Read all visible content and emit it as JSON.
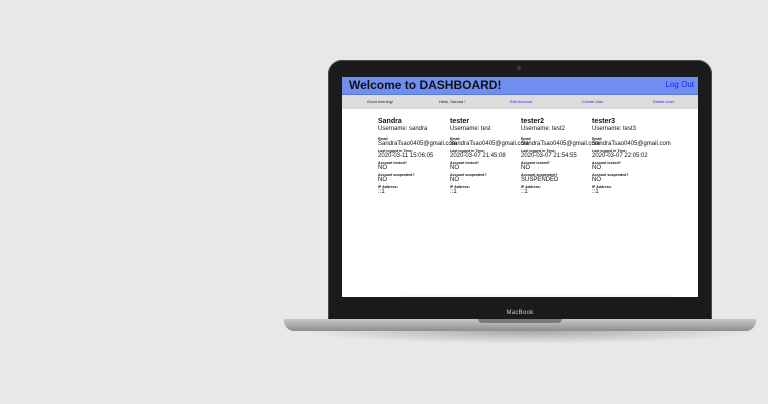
{
  "device": {
    "brand": "MacBook"
  },
  "app": {
    "title": "Welcome to DASHBOARD!",
    "logout": "Log Out",
    "accent_color": "#6f8ef0"
  },
  "nav": {
    "greeting": "Good evening!",
    "hello": "Hello, Sandra !",
    "edit_account": "Edit Account",
    "create_user": "Create User",
    "delete_user": "Delete User"
  },
  "labels": {
    "email": "Email",
    "last_logged": "Last logged in Time:",
    "locked": "Account locked?",
    "suspended": "Account suspended?",
    "ip": "IP Address:"
  },
  "users": [
    {
      "name": "Sandra",
      "username": "Username: sandra",
      "email": "SandraTsao0405@gmail.com",
      "last_logged": "2020-03-11 15:06:05",
      "locked": "NO",
      "suspended": "NO",
      "ip": "::1"
    },
    {
      "name": "tester",
      "username": "Username: test",
      "email": "SandraTsao0405@gmail.com",
      "last_logged": "2020-03-07 21:45:08",
      "locked": "NO",
      "suspended": "NO",
      "ip": "::1"
    },
    {
      "name": "tester2",
      "username": "Username: test2",
      "email": "SandraTsao0405@gmail.com",
      "last_logged": "2020-03-07 21:54:55",
      "locked": "NO",
      "suspended": "SUSPENDED",
      "ip": "::1"
    },
    {
      "name": "tester3",
      "username": "Username: test3",
      "email": "SandraTsao0405@gmail.com",
      "last_logged": "2020-03-07 22:05:02",
      "locked": "NO",
      "suspended": "NO",
      "ip": "::1"
    }
  ]
}
